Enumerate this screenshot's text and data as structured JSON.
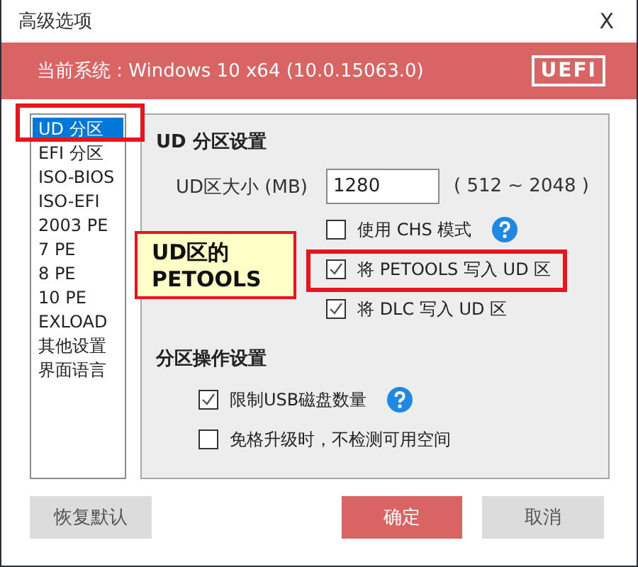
{
  "window": {
    "title": "高级选项",
    "close": "X"
  },
  "banner": {
    "system": "当前系统 : Windows 10 x64 (10.0.15063.0)",
    "badge": "UEFI"
  },
  "sidebar": {
    "items": [
      {
        "label": "UD 分区",
        "selected": true,
        "highlighted": true
      },
      {
        "label": "EFI 分区",
        "selected": false,
        "highlighted": false
      },
      {
        "label": "ISO-BIOS",
        "selected": false,
        "highlighted": false
      },
      {
        "label": "ISO-EFI",
        "selected": false,
        "highlighted": false
      },
      {
        "label": "2003 PE",
        "selected": false,
        "highlighted": false
      },
      {
        "label": "7 PE",
        "selected": false,
        "highlighted": false
      },
      {
        "label": "8 PE",
        "selected": false,
        "highlighted": false
      },
      {
        "label": "10 PE",
        "selected": false,
        "highlighted": false
      },
      {
        "label": "EXLOAD",
        "selected": false,
        "highlighted": false
      },
      {
        "label": "其他设置",
        "selected": false,
        "highlighted": false
      },
      {
        "label": "界面语言",
        "selected": false,
        "highlighted": false
      }
    ]
  },
  "panel": {
    "sections": [
      {
        "title": "UD 分区设置",
        "size_label": "UD区大小 (MB)",
        "size_value": "1280",
        "size_range": "( 512 ~ 2048 )",
        "options": [
          {
            "label": "使用 CHS 模式",
            "checked": false,
            "help": true,
            "highlighted": false
          },
          {
            "label": "将 PETOOLS 写入 UD 区",
            "checked": true,
            "help": false,
            "highlighted": true
          },
          {
            "label": "将 DLC 写入 UD 区",
            "checked": true,
            "help": false,
            "highlighted": false
          }
        ]
      },
      {
        "title": "分区操作设置",
        "options": [
          {
            "label": "限制USB磁盘数量",
            "checked": true,
            "help": true,
            "highlighted": false
          },
          {
            "label": "免格升级时，不检测可用空间",
            "checked": false,
            "help": false,
            "highlighted": false
          }
        ]
      }
    ]
  },
  "callout": {
    "text": "UD区的 PETOOLS"
  },
  "buttons": [
    {
      "label": "恢复默认",
      "kind": "secondary"
    },
    {
      "label": "确定",
      "kind": "primary"
    },
    {
      "label": "取消",
      "kind": "secondary"
    }
  ]
}
